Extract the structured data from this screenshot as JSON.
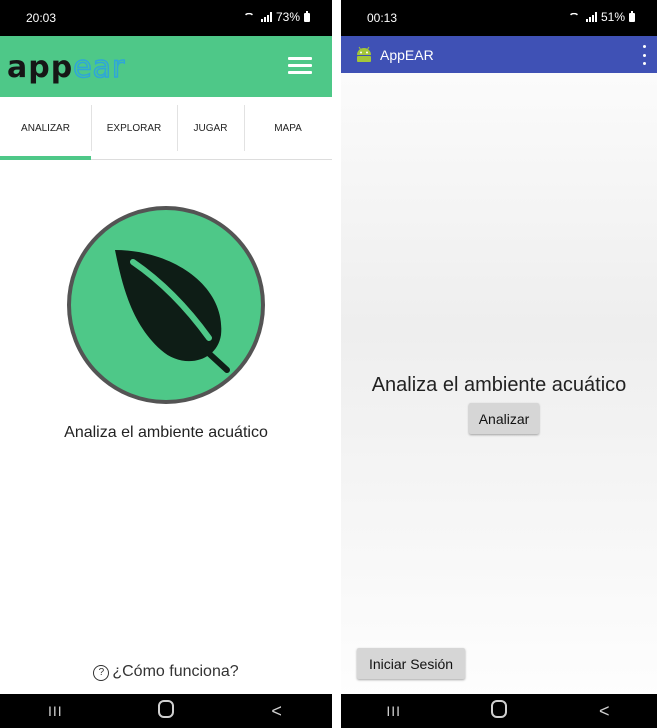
{
  "left_phone": {
    "status_bar": {
      "time": "20:03",
      "battery": "73%"
    },
    "header": {
      "logo_primary": "app",
      "logo_accent": "ear"
    },
    "tabs": [
      {
        "label": "ANALIZAR",
        "active": true
      },
      {
        "label": "EXPLORAR",
        "active": false
      },
      {
        "label": "JUGAR",
        "active": false
      },
      {
        "label": "MAPA",
        "active": false
      }
    ],
    "tagline": "Analiza el ambiente acuático",
    "help_icon_glyph": "?",
    "help_link": "¿Cómo funciona?",
    "nav": {
      "recent": "III",
      "back": "<"
    }
  },
  "right_phone": {
    "status_bar": {
      "time": "00:13",
      "battery": "51%"
    },
    "app_bar": {
      "title": "AppEAR"
    },
    "tagline": "Analiza el ambiente acuático",
    "analyze_button": "Analizar",
    "login_button": "Iniciar Sesión",
    "nav": {
      "recent": "III",
      "back": "<"
    }
  },
  "colors": {
    "brand_green": "#4ec888",
    "brand_blue": "#2fa6d8",
    "app_bar_indigo": "#3f51b5",
    "leaf_dark": "#0e1d16"
  }
}
